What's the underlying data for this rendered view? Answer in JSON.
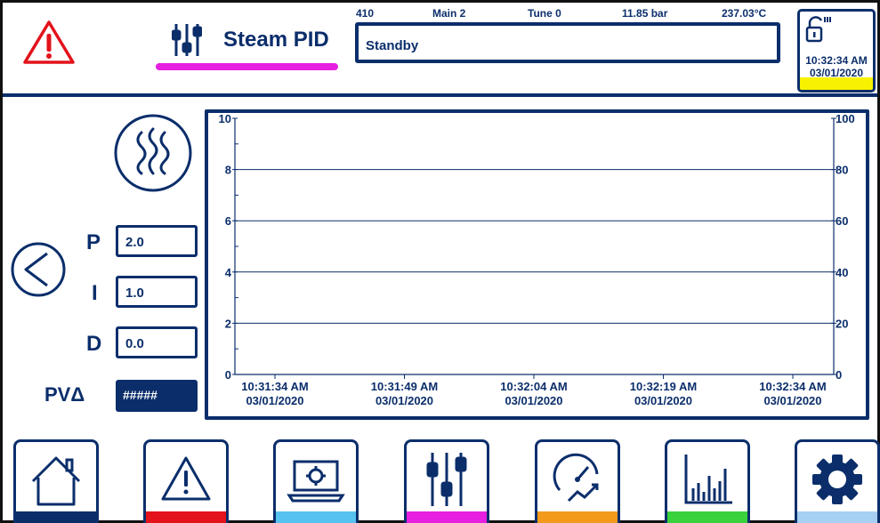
{
  "header": {
    "title": "Steam PID",
    "status": "Standby",
    "stats": {
      "id": "410",
      "main": "Main 2",
      "tune": "Tune 0",
      "pressure": "11.85  bar",
      "temperature": "237.03°C"
    },
    "clock": {
      "time": "10:32:34 AM",
      "date": "03/01/2020"
    }
  },
  "pid": {
    "p_label": "P",
    "p_value": "2.0",
    "i_label": "I",
    "i_value": "1.0",
    "d_label": "D",
    "d_value": "0.0",
    "pv_label": "PVΔ",
    "pv_value": "#####"
  },
  "chart_data": {
    "type": "line",
    "title": "",
    "xlabel": "",
    "ylabel": "",
    "y_left": {
      "ticks": [
        "10",
        "8",
        "6",
        "4",
        "2",
        "0"
      ],
      "ylim": [
        0,
        10
      ]
    },
    "y_right": {
      "ticks": [
        "100",
        "80",
        "60",
        "40",
        "20",
        "0"
      ],
      "ylim": [
        0,
        100
      ]
    },
    "x_ticks": [
      {
        "time": "10:31:34 AM",
        "date": "03/01/2020"
      },
      {
        "time": "10:31:49 AM",
        "date": "03/01/2020"
      },
      {
        "time": "10:32:04 AM",
        "date": "03/01/2020"
      },
      {
        "time": "10:32:19 AM",
        "date": "03/01/2020"
      },
      {
        "time": "10:32:34 AM",
        "date": "03/01/2020"
      }
    ],
    "grid": true,
    "series": []
  },
  "nav": [
    {
      "icon": "home-icon",
      "color": "#0b2e6b"
    },
    {
      "icon": "alarm-icon",
      "color": "#e3121b"
    },
    {
      "icon": "monitor-settings-icon",
      "color": "#56c2f0"
    },
    {
      "icon": "tuning-icon",
      "color": "#e61fe0"
    },
    {
      "icon": "gauge-trend-icon",
      "color": "#f39a1d"
    },
    {
      "icon": "bar-chart-icon",
      "color": "#39d13c"
    },
    {
      "icon": "settings-gear-icon",
      "color": "#a7cff2"
    }
  ],
  "colors": {
    "accent": "#0b2e6b",
    "alarm": "#e3121b",
    "highlight": "#e61fe0",
    "clock_bar": "#f7f200"
  }
}
